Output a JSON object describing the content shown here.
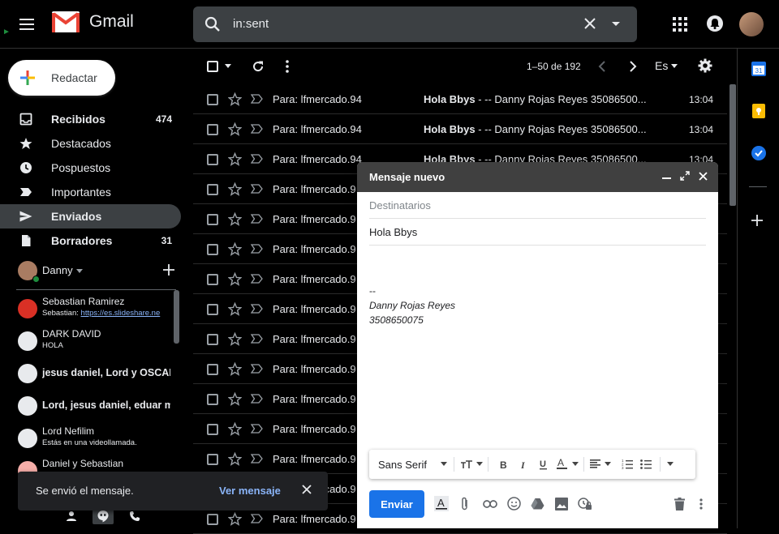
{
  "app": {
    "name": "Gmail"
  },
  "search": {
    "query": "in:sent"
  },
  "compose_button": {
    "label": "Redactar"
  },
  "nav": [
    {
      "label": "Recibidos",
      "count": "474",
      "bold": true
    },
    {
      "label": "Destacados",
      "count": "",
      "bold": false
    },
    {
      "label": "Pospuestos",
      "count": "",
      "bold": false
    },
    {
      "label": "Importantes",
      "count": "",
      "bold": false
    },
    {
      "label": "Enviados",
      "count": "",
      "bold": true,
      "active": true
    },
    {
      "label": "Borradores",
      "count": "31",
      "bold": true
    }
  ],
  "chat": {
    "me": "Danny",
    "contacts": [
      {
        "name": "Sebastian Ramirez",
        "status_prefix": "Sebastian: ",
        "status_link": "https://es.slideshare.ne"
      },
      {
        "name": "DARK DAVID",
        "status": "HOLA"
      },
      {
        "name": "jesus daniel, Lord y OSCAR",
        "status": ""
      },
      {
        "name": "Lord, jesus daniel, eduar m",
        "status": ""
      },
      {
        "name": "Lord Nefilim",
        "status": "Estás en una videollamada."
      },
      {
        "name": "Daniel y Sebastian",
        "status": ""
      }
    ]
  },
  "toolbar": {
    "pages": "1–50 de 192",
    "lang": "Es"
  },
  "emails": [
    {
      "to": "Para: lfmercado.94",
      "subject": "Hola Bbys",
      "snippet": " - -- Danny Rojas Reyes 35086500...",
      "time": "13:04"
    },
    {
      "to": "Para: lfmercado.94",
      "subject": "Hola Bbys",
      "snippet": " - -- Danny Rojas Reyes 35086500...",
      "time": "13:04"
    },
    {
      "to": "Para: lfmercado.94",
      "subject": "Hola Bbys",
      "snippet": " - -- Danny Rojas Reyes 35086500...",
      "time": "13:04"
    },
    {
      "to": "Para: lfmercado.9",
      "subject": "",
      "snippet": "",
      "time": ""
    },
    {
      "to": "Para: lfmercado.9",
      "subject": "",
      "snippet": "",
      "time": ""
    },
    {
      "to": "Para: lfmercado.9",
      "subject": "",
      "snippet": "",
      "time": ""
    },
    {
      "to": "Para: lfmercado.9",
      "subject": "",
      "snippet": "",
      "time": ""
    },
    {
      "to": "Para: lfmercado.9",
      "subject": "",
      "snippet": "",
      "time": ""
    },
    {
      "to": "Para: lfmercado.9",
      "subject": "",
      "snippet": "",
      "time": ""
    },
    {
      "to": "Para: lfmercado.9",
      "subject": "",
      "snippet": "",
      "time": ""
    },
    {
      "to": "Para: lfmercado.9",
      "subject": "",
      "snippet": "",
      "time": ""
    },
    {
      "to": "Para: lfmercado.9",
      "subject": "",
      "snippet": "",
      "time": ""
    },
    {
      "to": "Para: lfmercado.9",
      "subject": "",
      "snippet": "",
      "time": ""
    },
    {
      "to": "Para: lfmercado.9",
      "subject": "",
      "snippet": "",
      "time": ""
    },
    {
      "to": "Para: lfmercado.9",
      "subject": "",
      "snippet": "",
      "time": ""
    }
  ],
  "compose_window": {
    "title": "Mensaje nuevo",
    "recipients_placeholder": "Destinatarios",
    "subject": "Hola Bbys",
    "signature_sep": "--",
    "signature_name": "Danny Rojas Reyes",
    "signature_phone": "3508650075",
    "font": "Sans Serif",
    "send_label": "Enviar"
  },
  "toast": {
    "message": "Se envió el mensaje.",
    "action": "Ver mensaje"
  },
  "colors": {
    "accent": "#1a73e8",
    "gmail_red": "#ea4335",
    "background": "#000000"
  }
}
